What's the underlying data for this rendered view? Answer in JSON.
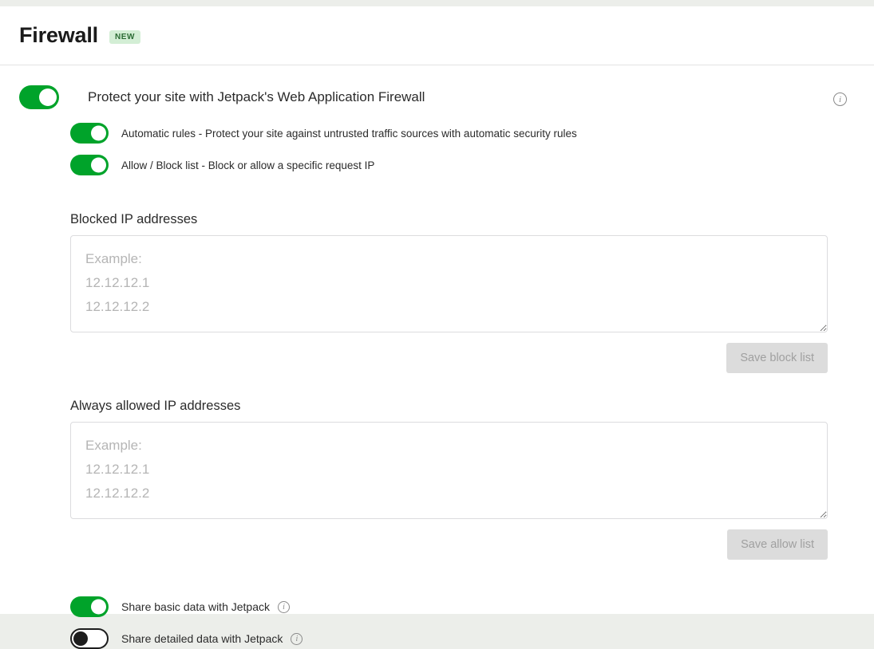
{
  "header": {
    "title": "Firewall",
    "badge": "NEW"
  },
  "main_toggle": {
    "label": "Protect your site with Jetpack's Web Application Firewall",
    "state": "on",
    "info_icon": "info-icon"
  },
  "sub_toggles": [
    {
      "label": "Automatic rules - Protect your site against untrusted traffic sources with automatic security rules",
      "state": "on"
    },
    {
      "label": "Allow / Block list - Block or allow a specific request IP",
      "state": "on"
    }
  ],
  "blocked_ips": {
    "label": "Blocked IP addresses",
    "value": "",
    "placeholder": "Example:\n12.12.12.1\n12.12.12.2",
    "save_label": "Save block list",
    "save_disabled": true
  },
  "allowed_ips": {
    "label": "Always allowed IP addresses",
    "value": "",
    "placeholder": "Example:\n12.12.12.1\n12.12.12.2",
    "save_label": "Save allow list",
    "save_disabled": true
  },
  "share_toggles": [
    {
      "label": "Share basic data with Jetpack",
      "state": "on",
      "info_icon": "info-icon"
    },
    {
      "label": "Share detailed data with Jetpack",
      "state": "off",
      "info_icon": "info-icon"
    }
  ],
  "colors": {
    "toggle_on": "#00a32a",
    "badge_bg": "#d3eed5",
    "badge_text": "#2b6b33",
    "page_bg": "#eceeea"
  }
}
